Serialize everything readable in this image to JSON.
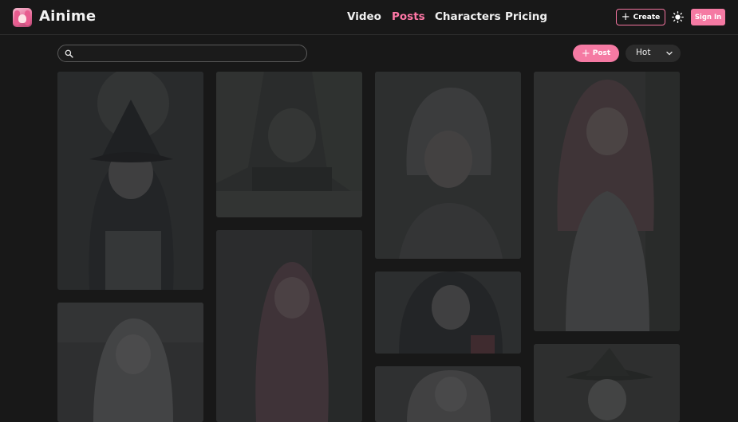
{
  "header": {
    "brand": "Ainime",
    "nav": {
      "video": "Video",
      "posts": "Posts",
      "characters": "Characters",
      "pricing": "Pricing"
    },
    "active_nav": "Posts",
    "create_label": "Create",
    "signin_label": "Sign In",
    "theme_icon": "sun-icon"
  },
  "toolbar": {
    "search_value": "",
    "search_placeholder": "",
    "post_label": "Post",
    "sort_value": "Hot"
  },
  "colors": {
    "accent": "#f57aa3",
    "active_nav": "#ff77a6",
    "background": "#181818"
  },
  "feed": {
    "cards": [
      {
        "subject": "dark-haired-witch-hat-girl"
      },
      {
        "subject": "girl-in-forest"
      },
      {
        "subject": "short-white-haired-girl"
      },
      {
        "subject": "pink-haired-girl-in-white"
      },
      {
        "subject": "pink-long-haired-girl"
      },
      {
        "subject": "white-haired-girl-smiling"
      },
      {
        "subject": "dark-haired-girl-closeup"
      },
      {
        "subject": "white-haired-girl"
      },
      {
        "subject": "white-haired-witch"
      }
    ]
  }
}
